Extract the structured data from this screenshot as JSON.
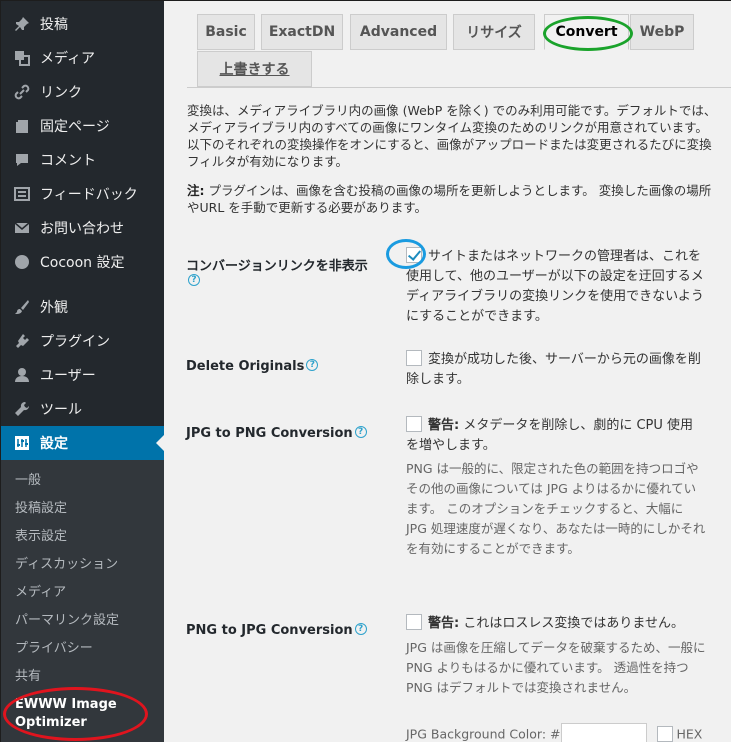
{
  "sidebar": {
    "items": [
      {
        "label": "投稿",
        "icon": "pin-icon"
      },
      {
        "label": "メディア",
        "icon": "media-icon"
      },
      {
        "label": "リンク",
        "icon": "link-icon"
      },
      {
        "label": "固定ページ",
        "icon": "page-icon"
      },
      {
        "label": "コメント",
        "icon": "comment-icon"
      },
      {
        "label": "フィードバック",
        "icon": "feedback-icon"
      },
      {
        "label": "お問い合わせ",
        "icon": "mail-icon"
      },
      {
        "label": "Cocoon 設定",
        "icon": "circle-icon"
      },
      {
        "label": "外観",
        "icon": "brush-icon"
      },
      {
        "label": "プラグイン",
        "icon": "plugin-icon"
      },
      {
        "label": "ユーザー",
        "icon": "user-icon"
      },
      {
        "label": "ツール",
        "icon": "wrench-icon"
      },
      {
        "label": "設定",
        "icon": "settings-icon"
      }
    ],
    "submenu": [
      "一般",
      "投稿設定",
      "表示設定",
      "ディスカッション",
      "メディア",
      "パーマリンク設定",
      "プライバシー",
      "共有",
      "EWWW Image Optimizer"
    ]
  },
  "tabs": [
    "Basic",
    "ExactDN",
    "Advanced",
    "リサイズ",
    "Convert",
    "WebP",
    "上書きする"
  ],
  "intro": "変換は、メディアライブラリ内の画像 (WebP を除く) でのみ利用可能です。デフォルトでは、メディアライブラリ内のすべての画像にワンタイム変換のためのリンクが用意されています。 以下のそれぞれの変換操作をオンにすると、画像がアップロードまたは変更されるたびに変換フィルタが有効になります。",
  "note": {
    "label": "注:",
    "text": " プラグインは、画像を含む投稿の画像の場所を更新しようとします。 変換した画像の場所やURL を手動で更新する必要があります。"
  },
  "settings": {
    "hide_links": {
      "label": "コンバージョンリンクを非表示",
      "text": "サイトまたはネットワークの管理者は、これを使用して、他のユーザーが以下の設定を迂回するメディアライブラリの変換リンクを使用できないようにすることができます。"
    },
    "delete_originals": {
      "label": "Delete Originals",
      "text": "変換が成功した後、サーバーから元の画像を削除します。"
    },
    "jpg_to_png": {
      "label": "JPG to PNG Conversion",
      "warning": "警告:",
      "text": " メタデータを削除し、劇的に CPU 使用を増やします。",
      "desc": "PNG は一般的に、限定された色の範囲を持つロゴやその他の画像については JPG よりはるかに優れています。 このオプションをチェックすると、大幅に JPG 処理速度が遅くなり、あなたは一時的にしかそれを有効にすることができます。"
    },
    "png_to_jpg": {
      "label": "PNG to JPG Conversion",
      "warning": "警告:",
      "text": " これはロスレス変換ではありません。",
      "desc": "JPG は画像を圧縮してデータを破棄するため、一般にPNG よりもはるかに優れています。 透過性を持つPNG はデフォルトでは変換されません。",
      "bg_label": "JPG Background Color: #",
      "hex_label": "HEX"
    }
  },
  "help_glyph": "?"
}
